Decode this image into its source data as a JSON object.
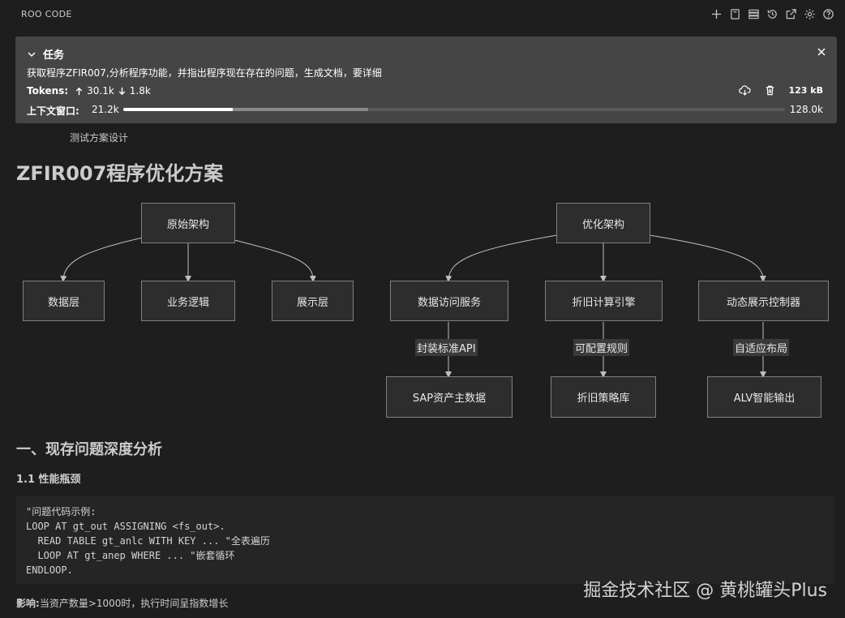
{
  "header": {
    "title": "ROO CODE",
    "icons": [
      "plus-icon",
      "file-icon",
      "server-icon",
      "history-icon",
      "popout-icon",
      "gear-icon",
      "help-icon"
    ]
  },
  "task": {
    "heading": "任务",
    "description": "获取程序ZFIR007,分析程序功能，并指出程序现在存在的问题，生成文档，要详细",
    "tokens_label": "Tokens:",
    "tokens_in": "30.1k",
    "tokens_out": "1.8k",
    "size": "123 kB",
    "context_label": "上下文窗口:",
    "context_used": "21.2k",
    "context_max": "128.0k",
    "context_fraction": 0.165,
    "context_reserved_fraction": 0.37
  },
  "sub_label": "测试方案设计",
  "doc": {
    "title": "ZFIR007程序优化方案"
  },
  "diagram": {
    "left_root": "原始架构",
    "left_children": [
      "数据层",
      "业务逻辑",
      "展示层"
    ],
    "right_root": "优化架构",
    "right_children": [
      "数据访问服务",
      "折旧计算引擎",
      "动态展示控制器"
    ],
    "edge_labels": [
      "封装标准API",
      "可配置规则",
      "自适应布局"
    ],
    "leaves": [
      "SAP资产主数据",
      "折旧策略库",
      "ALV智能输出"
    ]
  },
  "section": {
    "heading": "一、现存问题深度分析",
    "subheading": "1.1 性能瓶颈",
    "code_lines": [
      "\"问题代码示例:",
      "LOOP AT gt_out ASSIGNING <fs_out>.",
      "  READ TABLE gt_anlc WITH KEY ... \"全表遍历",
      "  LOOP AT gt_anep WHERE ... \"嵌套循环",
      "ENDLOOP."
    ],
    "impact_label": "影响:",
    "impact_text": "当资产数量>1000时，执行时间呈指数增长"
  },
  "watermark": "掘金技术社区 @ 黄桃罐头Plus",
  "colors": {
    "background": "#1e1e1e",
    "panel": "#454545",
    "node": "#2d2d2d"
  }
}
